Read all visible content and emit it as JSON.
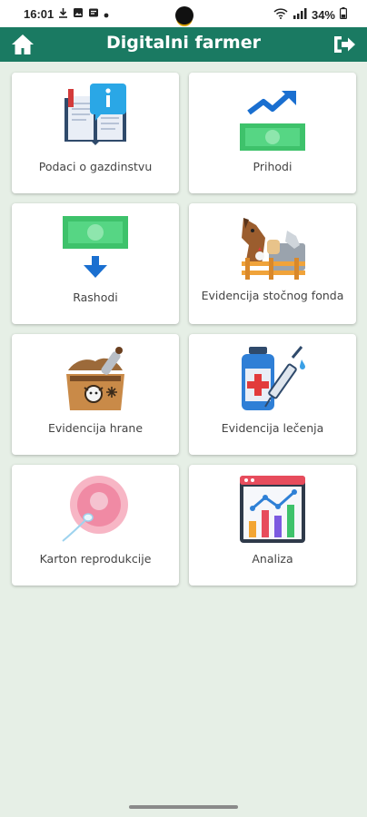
{
  "status_bar": {
    "time": "16:01",
    "battery": "34%",
    "icons": [
      "download-icon",
      "image-icon",
      "message-icon",
      "dot-icon",
      "wifi-icon",
      "signal-icon",
      "battery-icon"
    ]
  },
  "app_bar": {
    "title": "Digitalni farmer",
    "left_icon": "home-icon",
    "right_icon": "logout-icon",
    "color": "#1a7a62"
  },
  "menu": [
    {
      "label": "Podaci o gazdinstvu",
      "icon": "info-book-icon"
    },
    {
      "label": "Prihodi",
      "icon": "income-icon"
    },
    {
      "label": "Rashodi",
      "icon": "expense-icon"
    },
    {
      "label": "Evidencija stočnog fonda",
      "icon": "livestock-icon"
    },
    {
      "label": "Evidencija hrane",
      "icon": "feed-sack-icon"
    },
    {
      "label": "Evidencija lečenja",
      "icon": "vaccine-icon"
    },
    {
      "label": "Karton reprodukcije",
      "icon": "fertilization-icon"
    },
    {
      "label": "Analiza",
      "icon": "analytics-icon"
    }
  ],
  "colors": {
    "background": "#e6efe6",
    "card": "#ffffff",
    "accent": "#1a7a62"
  }
}
